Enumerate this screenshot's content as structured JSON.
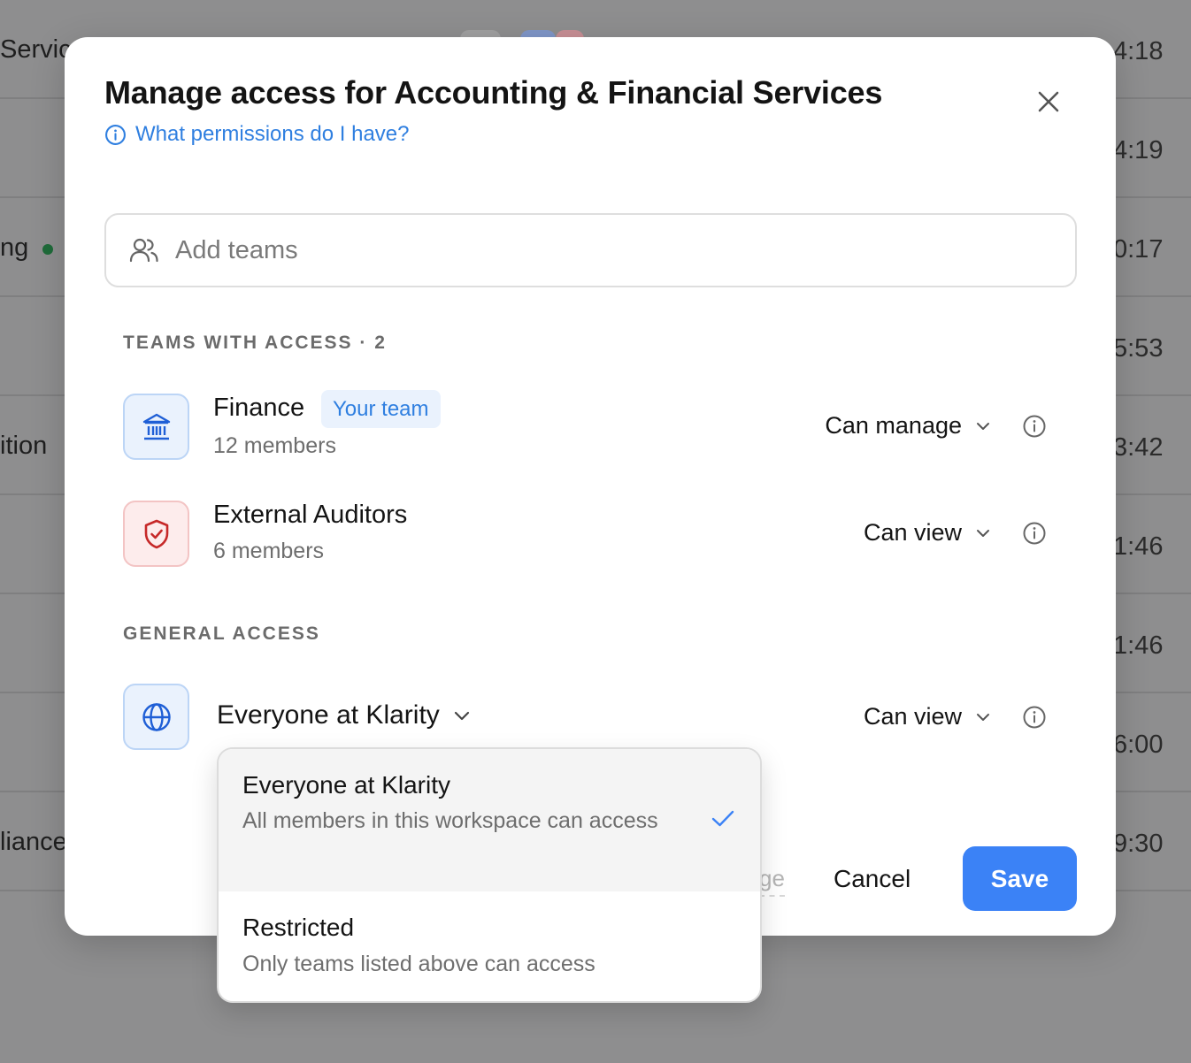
{
  "background": {
    "rows": [
      {
        "left": "Servic",
        "right": "4:18",
        "dot": false
      },
      {
        "left": "",
        "right": "4:19",
        "dot": false
      },
      {
        "left": "ng",
        "right": "0:17",
        "dot": true
      },
      {
        "left": "",
        "right": "5:53",
        "dot": false
      },
      {
        "left": "ition",
        "right": "3:42",
        "dot": false
      },
      {
        "left": "",
        "right": "1:46",
        "dot": false
      },
      {
        "left": "",
        "right": "1:46",
        "dot": false
      },
      {
        "left": "",
        "right": "6:00",
        "dot": false
      },
      {
        "left": "liance",
        "right": "9:30",
        "dot": false
      }
    ]
  },
  "modal": {
    "title": "Manage access for Accounting & Financial Services",
    "help_link": "What permissions do I have?",
    "search_placeholder": "Add teams",
    "teams_section_label": "TEAMS WITH ACCESS · 2",
    "teams": [
      {
        "name": "Finance",
        "badge": "Your team",
        "members": "12 members",
        "permission": "Can manage",
        "icon": "bank-icon"
      },
      {
        "name": "External Auditors",
        "members": "6 members",
        "permission": "Can view",
        "icon": "shield-check-icon"
      }
    ],
    "general_section_label": "GENERAL ACCESS",
    "general": {
      "name": "Everyone at Klarity",
      "permission": "Can view",
      "icon": "globe-icon"
    },
    "footer": {
      "ghost_link": "ge",
      "cancel": "Cancel",
      "save": "Save"
    }
  },
  "dropdown": {
    "options": [
      {
        "title": "Everyone at Klarity",
        "description": "All members in this workspace can access",
        "selected": true
      },
      {
        "title": "Restricted",
        "description": "Only teams listed above can access",
        "selected": false
      }
    ]
  },
  "colors": {
    "accent": "#3b82f6",
    "link": "#2f7fe0",
    "danger_icon": "#c62828"
  }
}
